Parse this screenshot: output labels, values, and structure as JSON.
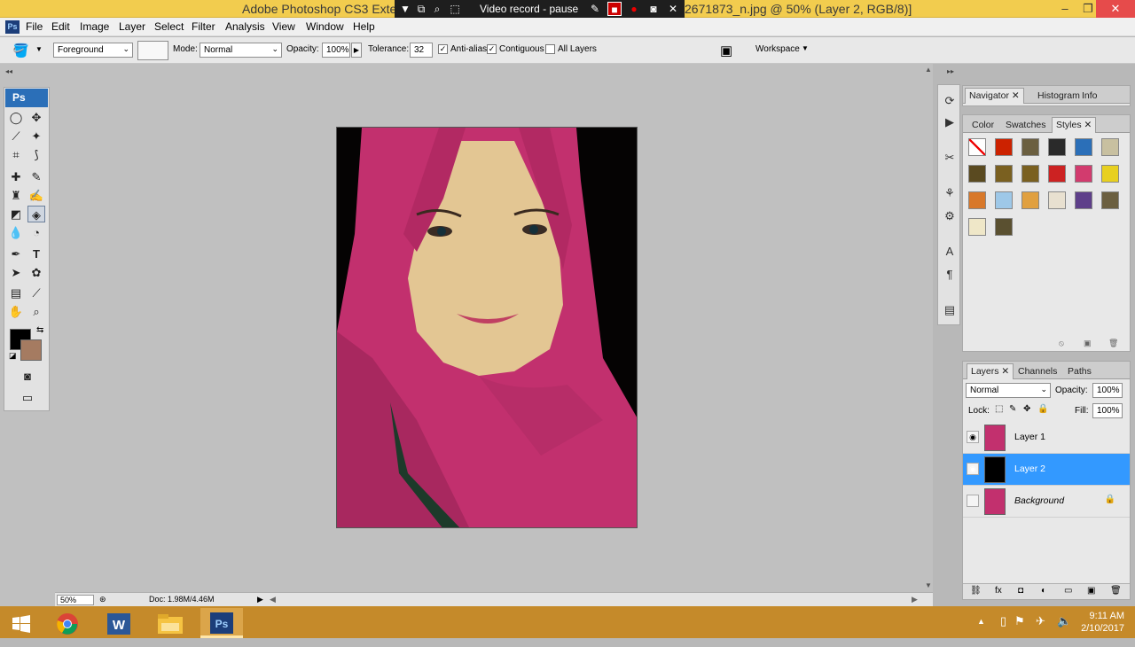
{
  "window": {
    "title_left": "Adobe Photoshop CS3 Exte",
    "title_right": "2671873_n.jpg @ 50% (Layer 2, RGB/8)]",
    "minimize": "–",
    "maximize": "❐",
    "close": "✕"
  },
  "recorder": {
    "label": "Video record - pause"
  },
  "menu": {
    "app_icon": "Ps",
    "items": [
      "File",
      "Edit",
      "Image",
      "Layer",
      "Select",
      "Filter",
      "Analysis",
      "View",
      "Window",
      "Help"
    ]
  },
  "options": {
    "fill_source": "Foreground",
    "mode_label": "Mode:",
    "mode_value": "Normal",
    "opacity_label": "Opacity:",
    "opacity_value": "100%",
    "tolerance_label": "Tolerance:",
    "tolerance_value": "32",
    "anti_alias": "Anti-alias",
    "contiguous": "Contiguous",
    "all_layers": "All Layers",
    "workspace": "Workspace"
  },
  "tools": {
    "logo": "Ps",
    "foreground_color": "#000000",
    "background_color": "#a57b61"
  },
  "status": {
    "zoom": "50%",
    "doc": "Doc: 1.98M/4.46M"
  },
  "panels": {
    "navigator_tabs": [
      "Navigator",
      "Histogram",
      "Info"
    ],
    "color_tabs": [
      "Color",
      "Swatches",
      "Styles"
    ],
    "layers_tabs": [
      "Layers",
      "Channels",
      "Paths"
    ],
    "blend_mode": "Normal",
    "opacity_label": "Opacity:",
    "opacity_value": "100%",
    "lock_label": "Lock:",
    "fill_label": "Fill:",
    "fill_value": "100%",
    "layers": [
      {
        "name": "Layer 1",
        "visible": true,
        "selected": false
      },
      {
        "name": "Layer 2",
        "visible": true,
        "selected": true
      },
      {
        "name": "Background",
        "visible": false,
        "selected": false,
        "locked": true
      }
    ],
    "styles_swatches": [
      "#ffffff",
      "#cc2200",
      "#6b5f40",
      "#2a2a2a",
      "#2b6fb8",
      "#c8c0a0",
      "#5a4a20",
      "#7a6020",
      "#7a6020",
      "#cc2222",
      "#d23b6e",
      "#e8d020",
      "#d8782a",
      "#9ec8e8",
      "#e0a040",
      "#e8e0d0",
      "#5e3f8a",
      "#6b5f40",
      "#efe7c8",
      "#5a5030"
    ]
  },
  "taskbar": {
    "apps": [
      "windows-start",
      "chrome",
      "word",
      "file-explorer",
      "photoshop"
    ],
    "time": "9:11 AM",
    "date": "2/10/2017"
  }
}
